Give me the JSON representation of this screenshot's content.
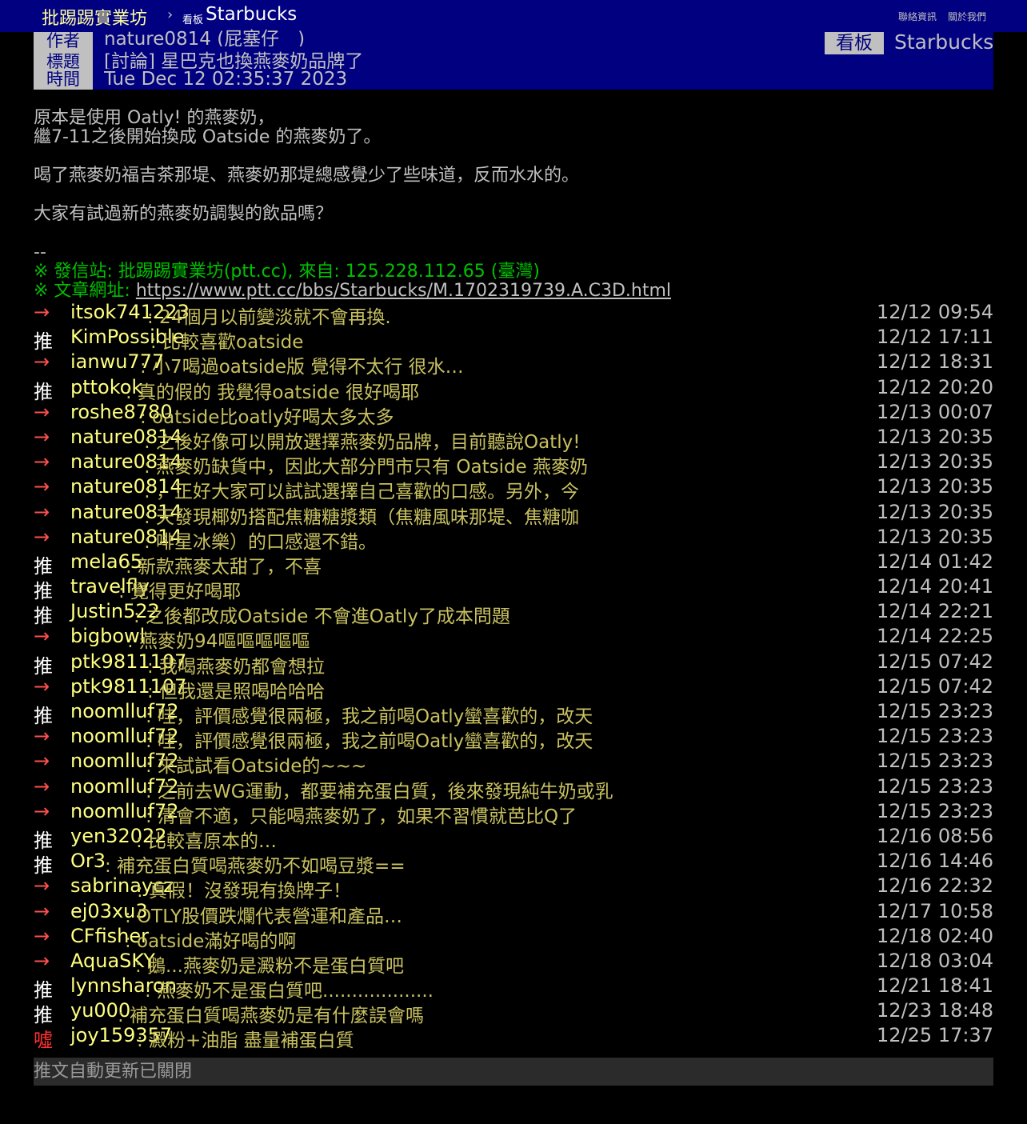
{
  "topbar": {
    "site": "批踢踢實業坊",
    "separator": "›",
    "board_tag": "看板",
    "board": "Starbucks",
    "links": [
      "聯絡資訊",
      "關於我們"
    ]
  },
  "meta": {
    "author_label": "作者",
    "author": "nature0814 (屁塞仔　)",
    "title_label": "標題",
    "title": "[討論] 星巴克也換燕麥奶品牌了",
    "time_label": "時間",
    "time": "Tue Dec 12 02:35:37 2023",
    "board_label": "看板",
    "board": "Starbucks"
  },
  "body": {
    "lines": [
      "原本是使用 Oatly! 的燕麥奶，",
      "繼7-11之後開始換成 Oatside 的燕麥奶了。",
      "喝了燕麥奶福吉茶那堤、燕麥奶那堤總感覺少了些味道，反而水水的。",
      "大家有試過新的燕麥奶調製的飲品嗎？",
      "--"
    ],
    "sig_site": "※ 發信站: 批踢踢實業坊(ptt.cc), 來自: 125.228.112.65 (臺灣)",
    "sig_url_label": "※ 文章網址: ",
    "sig_url": "https://www.ptt.cc/bbs/Starbucks/M.1702319739.A.C3D.html"
  },
  "pushes": [
    {
      "tag": "→",
      "type": "arrow",
      "user": "itsok741223",
      "content": ": 24個月以前變淡就不會再換.",
      "time": "12/12 09:54"
    },
    {
      "tag": "推",
      "type": "push",
      "user": "KimPossible",
      "content": ": 比較喜歡oatside",
      "time": "12/12 17:11"
    },
    {
      "tag": "→",
      "type": "arrow",
      "user": "ianwu777",
      "content": ": 小7喝過oatside版 覺得不太行 很水…",
      "time": "12/12 18:31"
    },
    {
      "tag": "推",
      "type": "push",
      "user": "pttokok",
      "content": ": 真的假的 我覺得oatside 很好喝耶",
      "time": "12/12 20:20"
    },
    {
      "tag": "→",
      "type": "arrow",
      "user": "roshe8780",
      "content": ": oatside比oatly好喝太多太多",
      "time": "12/13 00:07"
    },
    {
      "tag": "→",
      "type": "arrow",
      "user": "nature0814",
      "content": ": 之後好像可以開放選擇燕麥奶品牌，目前聽說Oatly!",
      "time": "12/13 20:35"
    },
    {
      "tag": "→",
      "type": "arrow",
      "user": "nature0814",
      "content": ": 燕麥奶缺貨中，因此大部分門市只有 Oatside 燕麥奶",
      "time": "12/13 20:35"
    },
    {
      "tag": "→",
      "type": "arrow",
      "user": "nature0814",
      "content": ": ，正好大家可以試試選擇自己喜歡的口感。另外，今",
      "time": "12/13 20:35"
    },
    {
      "tag": "→",
      "type": "arrow",
      "user": "nature0814",
      "content": ": 天發現椰奶搭配焦糖糖漿類（焦糖風味那堤、焦糖咖",
      "time": "12/13 20:35"
    },
    {
      "tag": "→",
      "type": "arrow",
      "user": "nature0814",
      "content": ": 啡星冰樂）的口感還不錯。",
      "time": "12/13 20:35"
    },
    {
      "tag": "推",
      "type": "push",
      "user": "mela65",
      "content": ": 新款燕麥太甜了，不喜",
      "time": "12/14 01:42"
    },
    {
      "tag": "推",
      "type": "push",
      "user": "travelfly",
      "content": ": 覺得更好喝耶",
      "time": "12/14 20:41"
    },
    {
      "tag": "推",
      "type": "push",
      "user": "Justin522",
      "content": ": 之後都改成Oatside 不會進Oatly了成本問題",
      "time": "12/14 22:21"
    },
    {
      "tag": "→",
      "type": "arrow",
      "user": "bigbowl",
      "content": ": 燕麥奶94嘔嘔嘔嘔嘔",
      "time": "12/14 22:25"
    },
    {
      "tag": "推",
      "type": "push",
      "user": "ptk9811107",
      "content": ": 我喝燕麥奶都會想拉",
      "time": "12/15 07:42"
    },
    {
      "tag": "→",
      "type": "arrow",
      "user": "ptk9811107",
      "content": ": 但我還是照喝哈哈哈",
      "time": "12/15 07:42"
    },
    {
      "tag": "推",
      "type": "push",
      "user": "noomlluf72",
      "content": ": 哇，評價感覺很兩極，我之前喝Oatly蠻喜歡的，改天",
      "time": "12/15 23:23"
    },
    {
      "tag": "→",
      "type": "arrow",
      "user": "noomlluf72",
      "content": ": 哇，評價感覺很兩極，我之前喝Oatly蠻喜歡的，改天",
      "time": "12/15 23:23"
    },
    {
      "tag": "→",
      "type": "arrow",
      "user": "noomlluf72",
      "content": ": 來試試看Oatside的~~~",
      "time": "12/15 23:23"
    },
    {
      "tag": "→",
      "type": "arrow",
      "user": "noomlluf72",
      "content": ": 之前去WG運動，都要補充蛋白質，後來發現純牛奶或乳",
      "time": "12/15 23:23"
    },
    {
      "tag": "→",
      "type": "arrow",
      "user": "noomlluf72",
      "content": ": 清會不適，只能喝燕麥奶了，如果不習慣就芭比Q了",
      "time": "12/15 23:23"
    },
    {
      "tag": "推",
      "type": "push",
      "user": "yen32022",
      "content": ": 比較喜原本的…",
      "time": "12/16 08:56"
    },
    {
      "tag": "推",
      "type": "push",
      "user": "Or3",
      "content": ": 補充蛋白質喝燕麥奶不如喝豆漿==",
      "time": "12/16 14:46"
    },
    {
      "tag": "→",
      "type": "arrow",
      "user": "sabrinaycz",
      "content": ": 真假！沒發現有換牌子！",
      "time": "12/16 22:32"
    },
    {
      "tag": "→",
      "type": "arrow",
      "user": "ej03xu3",
      "content": ": OTLY股價跌爛代表營運和產品…",
      "time": "12/17 10:58"
    },
    {
      "tag": "→",
      "type": "arrow",
      "user": "CFfisher",
      "content": ": oatside滿好喝的啊",
      "time": "12/18 02:40"
    },
    {
      "tag": "→",
      "type": "arrow",
      "user": "AquaSKY",
      "content": ": 鵝...燕麥奶是澱粉不是蛋白質吧",
      "time": "12/18 03:04"
    },
    {
      "tag": "推",
      "type": "push",
      "user": "lynnsharon",
      "content": ": 燕麥奶不是蛋白質吧...................",
      "time": "12/21 18:41"
    },
    {
      "tag": "推",
      "type": "push",
      "user": "yu000",
      "content": ": 補充蛋白質喝燕麥奶是有什麼誤會嗎",
      "time": "12/23 18:48"
    },
    {
      "tag": "噓",
      "type": "boo",
      "user": "joy159357",
      "content": ": 澱粉+油脂 盡量補蛋白質",
      "time": "12/25 17:37"
    }
  ],
  "footer": "推文自動更新已關閉"
}
